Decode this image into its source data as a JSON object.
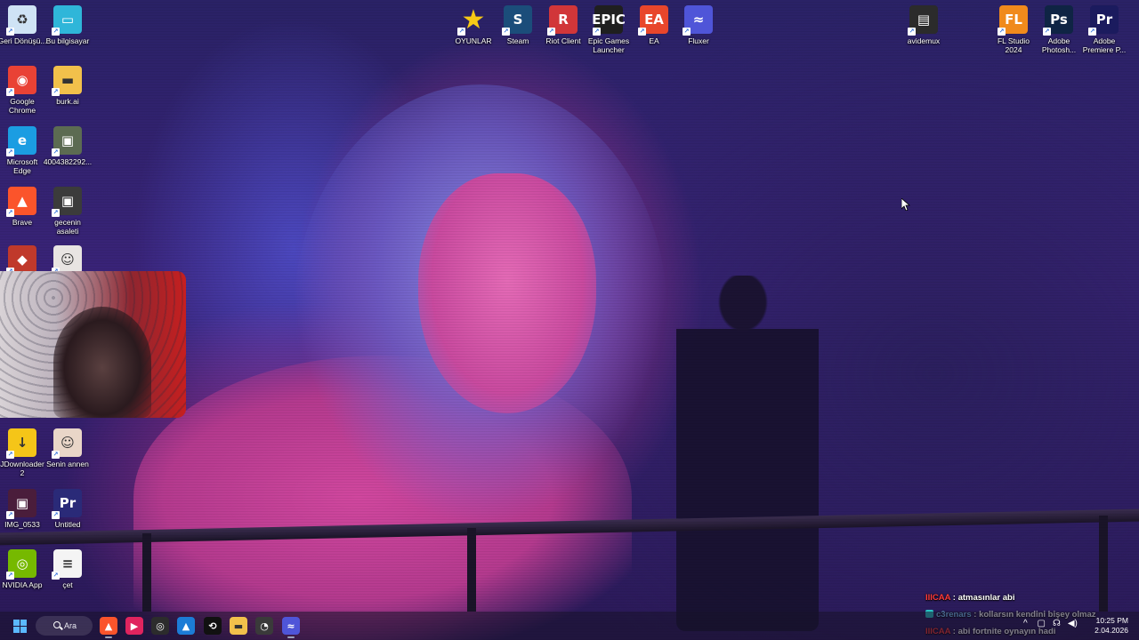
{
  "desktop": {
    "left_icons": [
      {
        "id": "recycle-bin",
        "label": "Geri Dönüşü...",
        "icon": "recycle-bin-icon",
        "color": "#cfe3f5"
      },
      {
        "id": "this-pc",
        "label": "Bu bilgisayar",
        "icon": "monitor-icon",
        "color": "#2fb6d9"
      },
      {
        "id": "chrome",
        "label": "Google Chrome",
        "icon": "chrome-icon",
        "color": "#e94235"
      },
      {
        "id": "burk-ai",
        "label": "burk.ai",
        "icon": "folder-icon",
        "color": "#f2c14b"
      },
      {
        "id": "edge",
        "label": "Microsoft Edge",
        "icon": "edge-icon",
        "color": "#1b9de2"
      },
      {
        "id": "image-4004",
        "label": "4004382292...",
        "icon": "image-file-icon",
        "color": "#5c6b52"
      },
      {
        "id": "brave",
        "label": "Brave",
        "icon": "brave-icon",
        "color": "#fb542b"
      },
      {
        "id": "gecenin-asaleti",
        "label": "gecenin asaleti",
        "icon": "image-file-icon",
        "color": "#3b3b3b"
      },
      {
        "id": "partial-app",
        "label": "",
        "icon": "app-icon",
        "color": "#c0392b"
      },
      {
        "id": "portrait-file",
        "label": "",
        "icon": "image-file-icon",
        "color": "#e8e4e2"
      },
      {
        "id": "jdownloader",
        "label": "JDownloader 2",
        "icon": "jdownloader-icon",
        "color": "#f5c518"
      },
      {
        "id": "senin-annen",
        "label": "Senin annen",
        "icon": "image-file-icon",
        "color": "#e9d6c8"
      },
      {
        "id": "img-0533",
        "label": "IMG_0533",
        "icon": "image-file-icon",
        "color": "#4a1d3b"
      },
      {
        "id": "untitled",
        "label": "Untitled",
        "icon": "premiere-project-icon",
        "color": "#2a2a78"
      },
      {
        "id": "nvidia",
        "label": "NVIDIA App",
        "icon": "nvidia-icon",
        "color": "#76b900"
      },
      {
        "id": "cet",
        "label": "çet",
        "icon": "text-file-icon",
        "color": "#f4f4f4"
      }
    ],
    "top_icons": [
      {
        "id": "oyunlar",
        "label": "OYUNLAR",
        "icon": "star-icon",
        "glyph": "★",
        "color": "#f6c915"
      },
      {
        "id": "steam",
        "label": "Steam",
        "icon": "steam-icon",
        "glyph": "S",
        "color": "#1b4d7a"
      },
      {
        "id": "riot",
        "label": "Riot Client",
        "icon": "riot-icon",
        "glyph": "R",
        "color": "#d13639"
      },
      {
        "id": "epic",
        "label": "Epic Games Launcher",
        "icon": "epic-games-icon",
        "glyph": "EPIC",
        "color": "#1f1f1f"
      },
      {
        "id": "ea",
        "label": "EA",
        "icon": "ea-icon",
        "glyph": "EA",
        "color": "#e8462b"
      },
      {
        "id": "fluxer",
        "label": "Fluxer",
        "icon": "fluxer-icon",
        "glyph": "≈",
        "color": "#4f55d8"
      }
    ],
    "right_icons": [
      {
        "id": "avidemux",
        "label": "avidemux",
        "icon": "clapperboard-icon",
        "glyph": "▤",
        "color": "#2b2b2b"
      },
      {
        "id": "fl-studio",
        "label": "FL Studio 2024",
        "icon": "fl-studio-icon",
        "glyph": "FL",
        "color": "#f08a1c"
      },
      {
        "id": "photoshop",
        "label": "Adobe Photosh...",
        "icon": "photoshop-icon",
        "glyph": "Ps",
        "color": "#0f2444"
      },
      {
        "id": "premiere",
        "label": "Adobe Premiere P...",
        "icon": "premiere-icon",
        "glyph": "Pr",
        "color": "#1b1b5e"
      }
    ],
    "glyphs": {
      "recycle-bin": "♻",
      "this-pc": "▭",
      "chrome": "◉",
      "burk-ai": "▬",
      "edge": "e",
      "image-4004": "▣",
      "brave": "▲",
      "gecenin-asaleti": "▣",
      "partial-app": "◆",
      "portrait-file": "☺",
      "jdownloader": "↓",
      "senin-annen": "☺",
      "img-0533": "▣",
      "untitled": "Pr",
      "nvidia": "◎",
      "cet": "≡"
    }
  },
  "chat": [
    {
      "user": "IIICAA",
      "sep": " : ",
      "message": "atmasınlar abi",
      "badge": false
    },
    {
      "user": "c3renars",
      "sep": " : ",
      "message": "kollarsın kendini bişey olmaz",
      "badge": true
    },
    {
      "user": "IIICAA",
      "sep": " : ",
      "message": "abi fortnite oynayın hadi",
      "badge": false
    }
  ],
  "taskbar": {
    "search_label": "Ara",
    "apps": [
      {
        "id": "brave",
        "icon": "brave-icon",
        "glyph": "▲",
        "color": "#fb542b",
        "active": true
      },
      {
        "id": "media-player",
        "icon": "play-icon",
        "glyph": "▶",
        "color": "#e0245e",
        "active": false
      },
      {
        "id": "obs",
        "icon": "obs-icon",
        "glyph": "◎",
        "color": "#2c2c2c",
        "active": false
      },
      {
        "id": "photos",
        "icon": "photos-icon",
        "glyph": "▲",
        "color": "#1c7cd6",
        "active": false
      },
      {
        "id": "capcut",
        "icon": "capcut-icon",
        "glyph": "⟲",
        "color": "#111111",
        "active": false
      },
      {
        "id": "file-explorer",
        "icon": "folder-icon",
        "glyph": "▬",
        "color": "#f2c14b",
        "active": false
      },
      {
        "id": "app-badge",
        "icon": "app-icon",
        "glyph": "◔",
        "color": "#3a3a3a",
        "active": false
      },
      {
        "id": "fluxer",
        "icon": "fluxer-icon",
        "glyph": "≈",
        "color": "#4f55d8",
        "active": true
      }
    ],
    "tray_chevron": "^",
    "tray_icons": [
      "▢",
      "☊",
      "◀)"
    ],
    "time": "10:25 PM",
    "date": "2.04.2026"
  }
}
